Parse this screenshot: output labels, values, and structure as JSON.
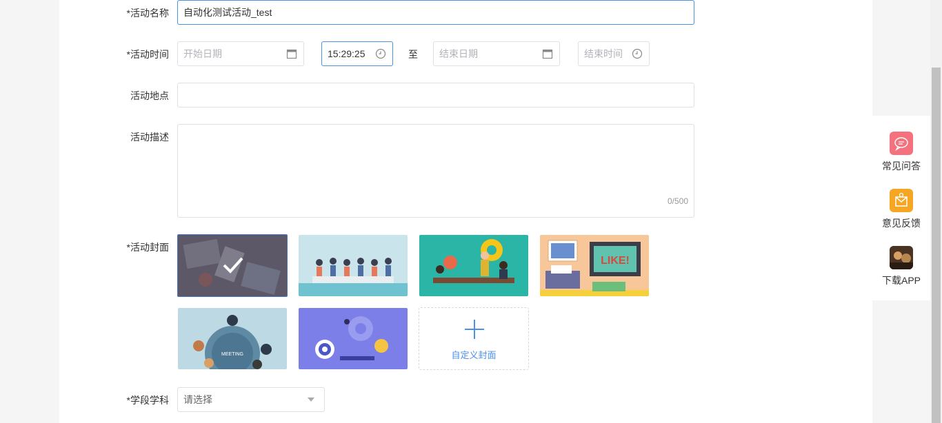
{
  "form": {
    "name": {
      "label": "*活动名称",
      "value": "自动化测试活动_test"
    },
    "time": {
      "label": "*活动时间",
      "start_date_placeholder": "开始日期",
      "start_time_value": "15:29:25",
      "to": "至",
      "end_date_placeholder": "结束日期",
      "end_time_placeholder": "结束时间"
    },
    "location": {
      "label": "活动地点",
      "value": ""
    },
    "description": {
      "label": "活动描述",
      "value": "",
      "counter": "0/500"
    },
    "cover": {
      "label": "*活动封面",
      "custom_label": "自定义封面",
      "selected_index": 0
    },
    "subject": {
      "label": "*学段学科",
      "placeholder": "请选择"
    }
  },
  "sidebar": {
    "items": [
      {
        "label": "常见问答",
        "icon": "chat-bubble-icon",
        "color": "#f4717d"
      },
      {
        "label": "意见反馈",
        "icon": "feedback-envelope-icon",
        "color": "#f5a623"
      },
      {
        "label": "下载APP",
        "icon": "app-thumbnail-icon",
        "color": "#6b4a2e"
      }
    ]
  },
  "colors": {
    "accent": "#4a90e2",
    "border": "#dcdfe6"
  }
}
